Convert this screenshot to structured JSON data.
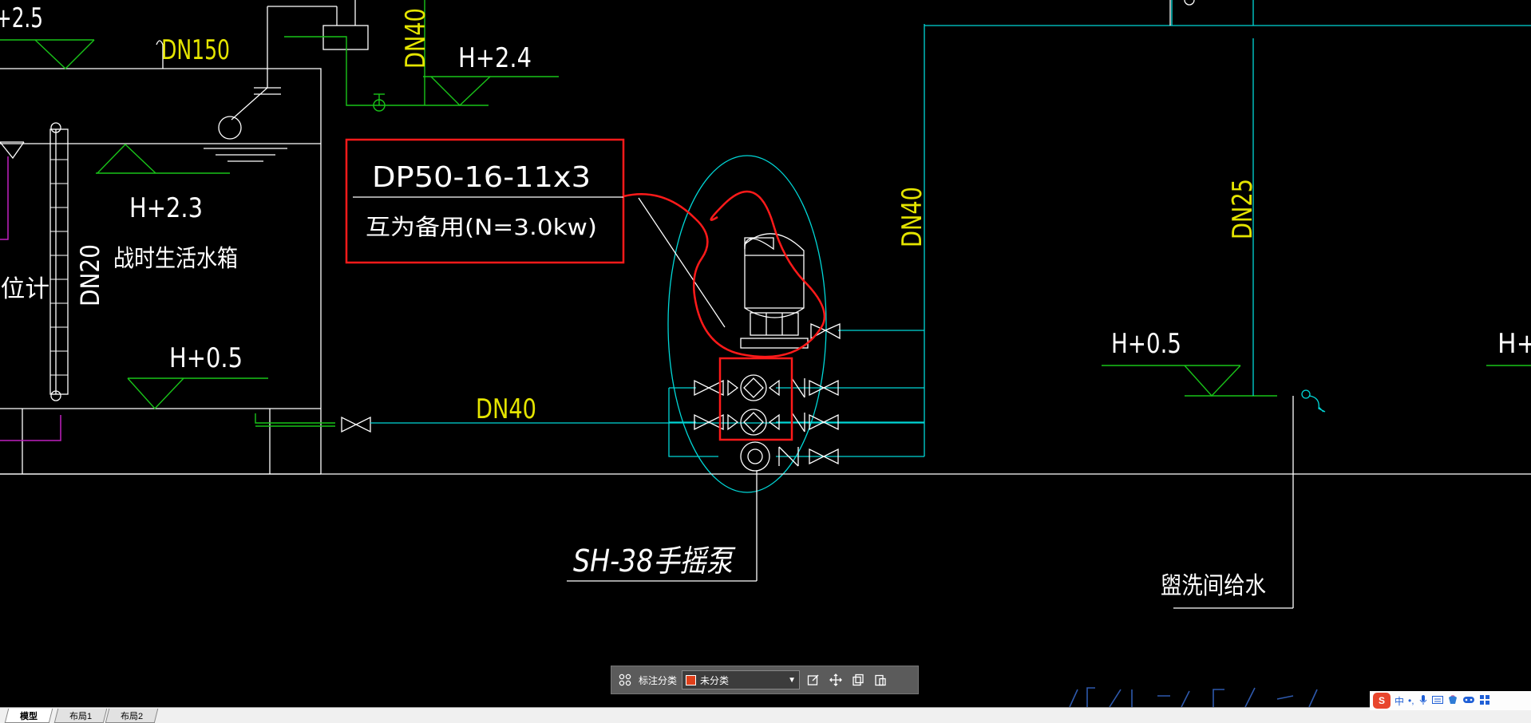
{
  "drawing": {
    "labels": {
      "top_left_elev": "+2.5",
      "pipe_dn150": "DN150",
      "pipe_dn40_vertical_left": "DN40",
      "elev_h24": "H+2.4",
      "elev_h23": "H+2.3",
      "tank_name": "战时生活水箱",
      "level_gauge": "水位计",
      "pipe_dn20": "DN20",
      "elev_h05_tank": "H+0.5",
      "pipe_dn40_horizontal": "DN40",
      "pump_model": "DP50-16-11x3",
      "pump_note": "互为备用(N=3.0kw)",
      "pipe_dn40_vertical_right": "DN40",
      "pipe_dn25": "DN25",
      "elev_h05_right": "H+0.5",
      "elev_h_cut": "H+",
      "hand_pump": "SH-38手摇泵",
      "washroom_supply": "盥洗间给水"
    },
    "colors": {
      "background": "#000000",
      "white_line": "#ffffff",
      "cyan_line": "#00d7d7",
      "green_line": "#19c419",
      "yellow_text": "#e5e500",
      "markup_red": "#ff1a1a",
      "magenta_line": "#c020c0"
    }
  },
  "toolbar": {
    "grid_icon": "grid-icon",
    "category_label": "标注分类",
    "category_value": "未分类",
    "tool_icons": [
      "edit-icon",
      "move-icon",
      "copy-icon",
      "paste-icon"
    ]
  },
  "tabs": [
    {
      "label": "模型",
      "active": true
    },
    {
      "label": "布局1",
      "active": false
    },
    {
      "label": "布局2",
      "active": false
    }
  ],
  "ime": {
    "logo": "S",
    "mode": "中",
    "punct": "•,",
    "icons": [
      "mic-icon",
      "keyboard-icon",
      "skin-icon",
      "game-icon",
      "apps-icon"
    ]
  }
}
